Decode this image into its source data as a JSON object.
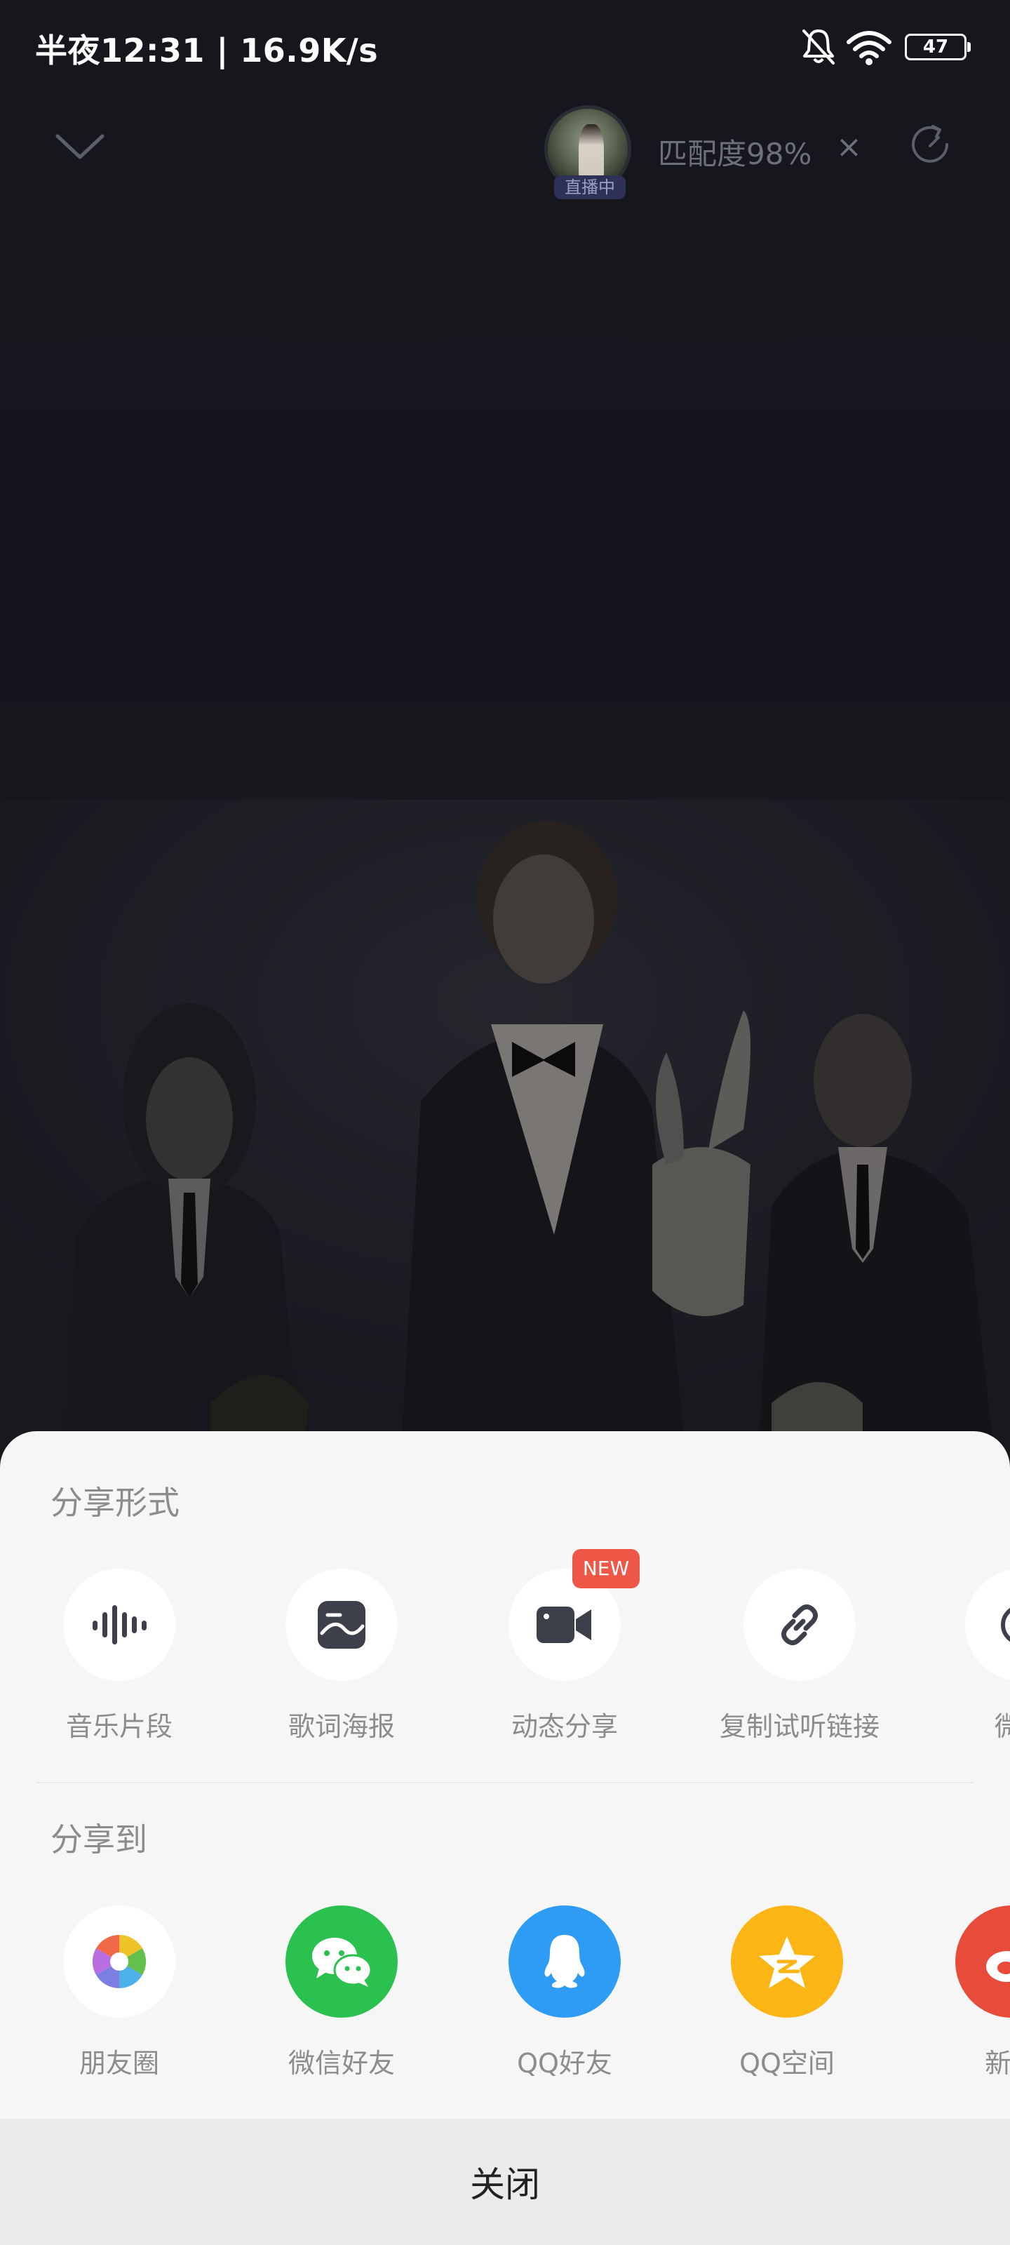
{
  "status_bar": {
    "time_speed": "半夜12:31 | 16.9K/s",
    "battery_level": "47",
    "icons": [
      "bell-muted-icon",
      "wifi-icon",
      "battery-icon"
    ]
  },
  "player": {
    "collapse_icon": "chevron-down-icon",
    "live": {
      "badge": "直播中",
      "match_text": "匹配度98%",
      "close_glyph": "×"
    },
    "refresh_icon": "refresh-icon"
  },
  "share_sheet": {
    "format_title": "分享形式",
    "format_items": [
      {
        "label": "音乐片段",
        "icon": "waveform-icon"
      },
      {
        "label": "歌词海报",
        "icon": "lyrics-poster-icon"
      },
      {
        "label": "动态分享",
        "icon": "video-camera-icon",
        "badge": "NEW"
      },
      {
        "label": "复制试听链接",
        "icon": "link-icon"
      },
      {
        "label": "微信",
        "icon": "wechat-partial-icon"
      }
    ],
    "target_title": "分享到",
    "target_items": [
      {
        "label": "朋友圈",
        "icon": "moments-icon",
        "color": "#ffffff"
      },
      {
        "label": "微信好友",
        "icon": "wechat-icon",
        "color": "#2bc14f"
      },
      {
        "label": "QQ好友",
        "icon": "qq-icon",
        "color": "#2e9bf5"
      },
      {
        "label": "QQ空间",
        "icon": "qzone-icon",
        "color": "#fbb515"
      },
      {
        "label": "新浪",
        "icon": "weibo-icon",
        "color": "#e84b3a"
      }
    ],
    "close_label": "关闭"
  }
}
